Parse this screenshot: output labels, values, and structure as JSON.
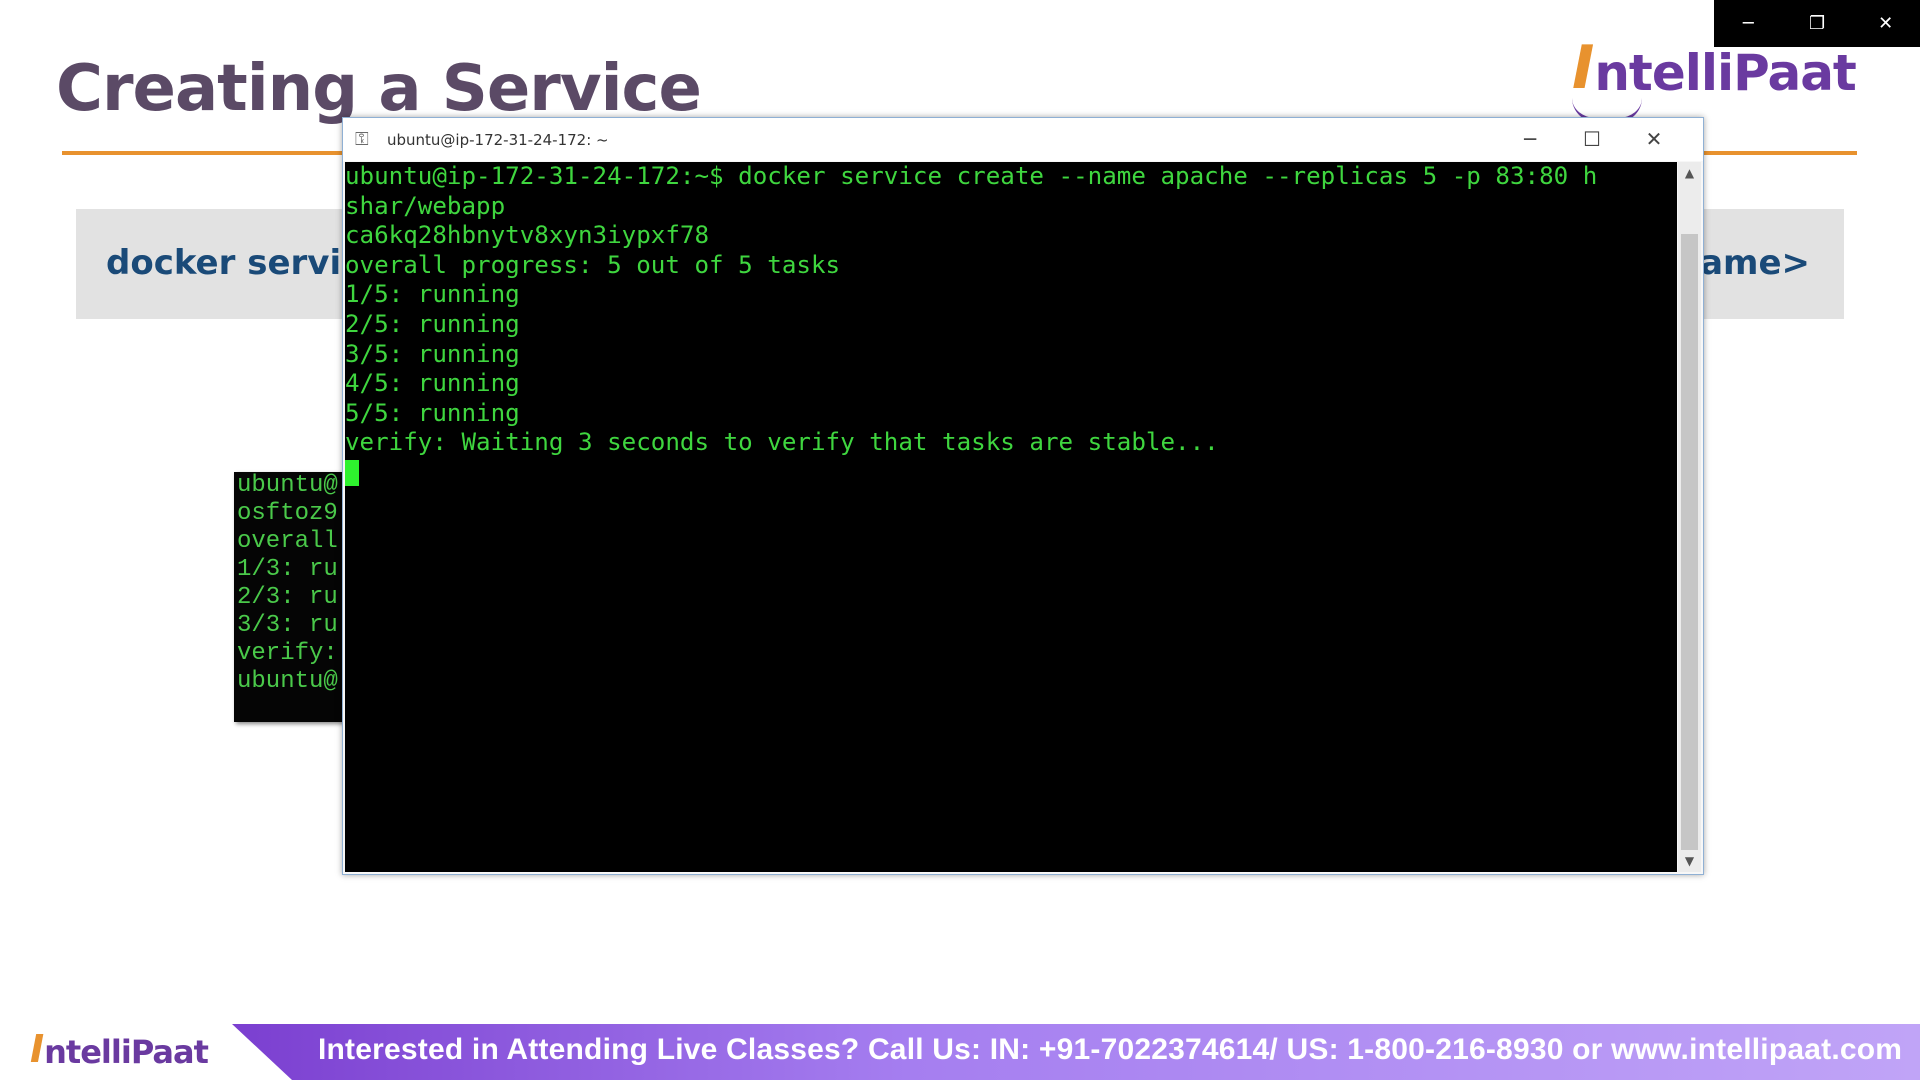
{
  "window_controls": {
    "minimize": "─",
    "restore": "❐",
    "close": "✕"
  },
  "slide": {
    "title": "Creating a Service",
    "logo": {
      "mark": "I",
      "text": "ntelliPaat"
    },
    "command_left": "docker servic",
    "command_right": "name>",
    "background_terminal_lines": [
      "ubuntu@",
      "osftoz9",
      "overall",
      "1/3: ru",
      "2/3: ru",
      "3/3: ru",
      "verify:",
      "ubuntu@"
    ]
  },
  "terminal": {
    "title": "ubuntu@ip-172-31-24-172: ~",
    "controls": {
      "minimize": "─",
      "maximize": "☐",
      "close": "✕"
    },
    "lines": [
      "ubuntu@ip-172-31-24-172:~$ docker service create --name apache --replicas 5 -p 83:80 h",
      "shar/webapp",
      "ca6kq28hbnytv8xyn3iypxf78",
      "overall progress: 5 out of 5 tasks",
      "1/5: running",
      "2/5: running",
      "3/5: running",
      "4/5: running",
      "5/5: running",
      "verify: Waiting 3 seconds to verify that tasks are stable..."
    ],
    "scroll_up": "▲",
    "scroll_down": "▼"
  },
  "banner": {
    "logo": {
      "mark": "I",
      "text": "ntelliPaat"
    },
    "message": "Interested in Attending Live Classes? Call Us: IN: +91-7022374614/ US: 1-800-216-8930 or www.intellipaat.com"
  },
  "colors": {
    "title": "#5b4a66",
    "accent_orange": "#e8922e",
    "brand_purple": "#6a3aa0",
    "command_blue": "#1a4a78",
    "terminal_text": "#3fd63f",
    "banner_purple": "#7b3fd0"
  }
}
